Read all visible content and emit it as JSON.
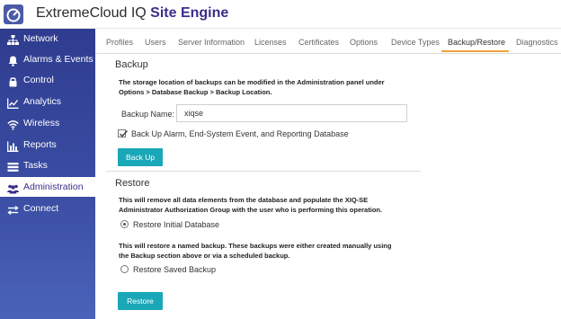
{
  "header": {
    "brand_name": "ExtremeCloud IQ",
    "brand_product": "Site Engine"
  },
  "sidebar": {
    "items": [
      {
        "label": "Network",
        "icon": "network-icon"
      },
      {
        "label": "Alarms & Events",
        "icon": "bell-icon"
      },
      {
        "label": "Control",
        "icon": "lock-icon"
      },
      {
        "label": "Analytics",
        "icon": "line-chart-icon"
      },
      {
        "label": "Wireless",
        "icon": "wifi-icon"
      },
      {
        "label": "Reports",
        "icon": "bar-chart-icon"
      },
      {
        "label": "Tasks",
        "icon": "tasks-icon"
      },
      {
        "label": "Administration",
        "icon": "users-icon",
        "active": true
      },
      {
        "label": "Connect",
        "icon": "exchange-icon"
      }
    ]
  },
  "tabs": [
    {
      "label": "Profiles"
    },
    {
      "label": "Users"
    },
    {
      "label": "Server Information"
    },
    {
      "label": "Licenses"
    },
    {
      "label": "Certificates"
    },
    {
      "label": "Options"
    },
    {
      "label": "Device Types"
    },
    {
      "label": "Backup/Restore",
      "active": true
    },
    {
      "label": "Diagnostics"
    }
  ],
  "backup": {
    "title": "Backup",
    "note_line1": "The storage location of backups can be modified in the Administration panel under",
    "note_line2": "Options > Database Backup > Backup Location.",
    "name_label": "Backup Name:",
    "name_value": "xiqse",
    "checkbox_label": "Back Up Alarm, End-System Event, and Reporting Database",
    "checkbox_checked": true,
    "button_label": "Back Up"
  },
  "restore": {
    "title": "Restore",
    "note1_line1": "This will remove all data elements from the database and populate the XIQ-SE",
    "note1_line2": "Administrator Authorization Group with the user who is performing this operation.",
    "option1_label": "Restore Initial Database",
    "option1_selected": true,
    "note2_line1": "This will restore a named backup. These backups were either created manually using",
    "note2_line2": "the Backup section above or via a scheduled backup.",
    "option2_label": "Restore Saved Backup",
    "option2_selected": false,
    "button_label": "Restore"
  },
  "colors": {
    "accent": "#1aa7b8",
    "sidebar": "#3b4fa5",
    "tab_underline": "#f2a33a",
    "brand": "#3b2e8a"
  }
}
